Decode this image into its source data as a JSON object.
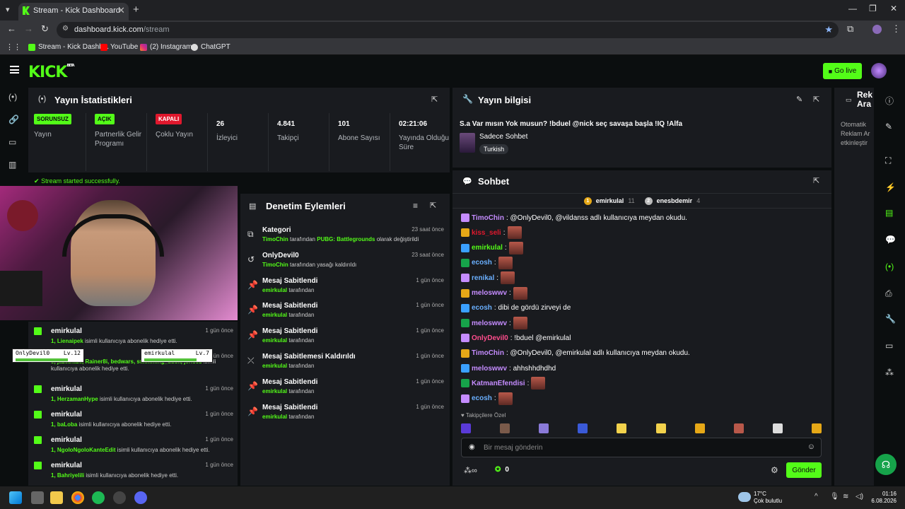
{
  "browser": {
    "tab_title": "Stream - Kick Dashboard",
    "url_host": "dashboard.kick.com",
    "url_path": "/stream",
    "bookmarks": [
      "Stream - Kick Dashb...",
      "YouTube",
      "(2) Instagram",
      "ChatGPT"
    ]
  },
  "header": {
    "logo": "KICK",
    "logo_beta": "BETA",
    "go_live": "Go live"
  },
  "stats": {
    "title": "Yayın İstatistikleri",
    "cols": [
      {
        "badge": "SORUNSUZ",
        "label": "Yayın"
      },
      {
        "badge": "AÇIK",
        "label": "Partnerlik Gelir Programı"
      },
      {
        "badge": "KAPALI",
        "label": "Çoklu Yayın"
      },
      {
        "value": "26",
        "label": "İzleyici"
      },
      {
        "value": "4.841",
        "label": "Takipçi"
      },
      {
        "value": "101",
        "label": "Abone Sayısı"
      },
      {
        "value": "02:21:06",
        "label": "Yayında Olduğu Süre"
      }
    ],
    "colors": {
      "ok": "#53fc18",
      "off": "#e0182d"
    }
  },
  "toast": "Stream started successfully.",
  "overlay": {
    "p1": "OnlyDevil0",
    "p1lv": "Lv.12",
    "p2": "emirkulal",
    "p2lv": "Lv.7"
  },
  "subs": [
    {
      "user": "emirkulal",
      "time": "1 gün önce",
      "count": "1,",
      "names": "Lienaipek",
      "text": " isimli kullanıcıya abonelik hediye etti."
    },
    {
      "user": "",
      "time": "1 gün önce",
      "count": "5,",
      "names": "jazeblaze, Rainer8i, bedwars, swimming_duck, jericoz",
      "text": " isimli kullanıcıya abonelik hediye etti."
    },
    {
      "user": "emirkulal",
      "time": "1 gün önce",
      "count": "1,",
      "names": "HerzamanHype",
      "text": " isimli kullanıcıya abonelik hediye etti."
    },
    {
      "user": "emirkulal",
      "time": "1 gün önce",
      "count": "1,",
      "names": "baLoba",
      "text": " isimli kullanıcıya abonelik hediye etti."
    },
    {
      "user": "emirkulal",
      "time": "1 gün önce",
      "count": "1,",
      "names": "NgoloNgoloKanteEdit",
      "text": " isimli kullanıcıya abonelik hediye etti."
    },
    {
      "user": "emirkulal",
      "time": "1 gün önce",
      "count": "1,",
      "names": "Bahriyelili",
      "text": " isimli kullanıcıya abonelik hediye etti."
    }
  ],
  "denetim": {
    "title": "Denetim Eylemleri",
    "rows": [
      {
        "icon": "⧉",
        "name": "Kategori",
        "time": "23 saat önce",
        "who": "TimoChin",
        "mid": " tarafından ",
        "target": "PUBG: Battlegrounds",
        "rest": " olarak değiştirildi"
      },
      {
        "icon": "↺",
        "name": "OnlyDevil0",
        "time": "23 saat önce",
        "who": "TimoChin",
        "mid": " tarafından yasağı kaldırıldı",
        "target": "",
        "rest": ""
      },
      {
        "icon": "📌",
        "name": "Mesaj Sabitlendi",
        "time": "1 gün önce",
        "who": "emirkulal",
        "mid": " tarafından",
        "target": "",
        "rest": ""
      },
      {
        "icon": "📌",
        "name": "Mesaj Sabitlendi",
        "time": "1 gün önce",
        "who": "emirkulal",
        "mid": " tarafından",
        "target": "",
        "rest": ""
      },
      {
        "icon": "📌",
        "name": "Mesaj Sabitlendi",
        "time": "1 gün önce",
        "who": "emirkulal",
        "mid": " tarafından",
        "target": "",
        "rest": ""
      },
      {
        "icon": "⤫",
        "name": "Mesaj Sabitlemesi Kaldırıldı",
        "time": "1 gün önce",
        "who": "emirkulal",
        "mid": " tarafından",
        "target": "",
        "rest": ""
      },
      {
        "icon": "📌",
        "name": "Mesaj Sabitlendi",
        "time": "1 gün önce",
        "who": "emirkulal",
        "mid": " tarafından",
        "target": "",
        "rest": ""
      },
      {
        "icon": "📌",
        "name": "Mesaj Sabitlendi",
        "time": "1 gün önce",
        "who": "emirkulal",
        "mid": " tarafından",
        "target": "",
        "rest": ""
      }
    ]
  },
  "yayin": {
    "title": "Yayın bilgisi",
    "stream_title": "S.a Var mısın Yok musun? !bduel @nick seç savaşa başla !IQ !Alfa",
    "category": "Sadece Sohbet",
    "tag": "Turkish"
  },
  "sohbet": {
    "title": "Sohbet",
    "top1": "emirkulal",
    "top1n": "11",
    "top2": "enesbdemir",
    "top2n": "4",
    "msgs": [
      {
        "user": "TimoChin",
        "color": "#c58cff",
        "text": ": @OnlyDevil0, @vildanss adlı kullanıcıya meydan okudu.",
        "emote": false
      },
      {
        "user": "kiss_seli",
        "color": "#e0182d",
        "text": ":",
        "emote": true
      },
      {
        "user": "emirkulal",
        "color": "#53fc18",
        "text": ":",
        "emote": true
      },
      {
        "user": "ecosh",
        "color": "#6ab0ff",
        "text": ":",
        "emote": true
      },
      {
        "user": "renikal",
        "color": "#6ab0ff",
        "text": ":",
        "emote": true
      },
      {
        "user": "meloswwv",
        "color": "#c58cff",
        "text": ":",
        "emote": true
      },
      {
        "user": "ecosh",
        "color": "#6ab0ff",
        "text": ": dibi de gördü zirveyi de",
        "emote": false
      },
      {
        "user": "meloswwv",
        "color": "#c58cff",
        "text": ":",
        "emote": true
      },
      {
        "user": "OnlyDevil0",
        "color": "#ff4d8d",
        "text": ": !bduel @emirkulal",
        "emote": false
      },
      {
        "user": "TimoChin",
        "color": "#c58cff",
        "text": ": @OnlyDevil0, @emirkulal adlı kullanıcıya meydan okudu.",
        "emote": false
      },
      {
        "user": "meloswwv",
        "color": "#c58cff",
        "text": ": ahhshhdhdhd",
        "emote": false
      },
      {
        "user": "KatmanEfendisi",
        "color": "#c58cff",
        "text": ":",
        "emote": true
      },
      {
        "user": "ecosh",
        "color": "#6ab0ff",
        "text": ":",
        "emote": true
      }
    ],
    "followers_only": "Takipçilere Özel",
    "placeholder": "Bir mesaj gönderin",
    "points": "0",
    "send": "Gönder"
  },
  "reklam": {
    "title": "Rekl Ara",
    "text": "Otomatik Reklam Ar etkinleştir"
  },
  "taskbar": {
    "temp": "17°C",
    "weather": "Çok bulutlu",
    "time": "01:16",
    "date": "6.08.2026"
  }
}
